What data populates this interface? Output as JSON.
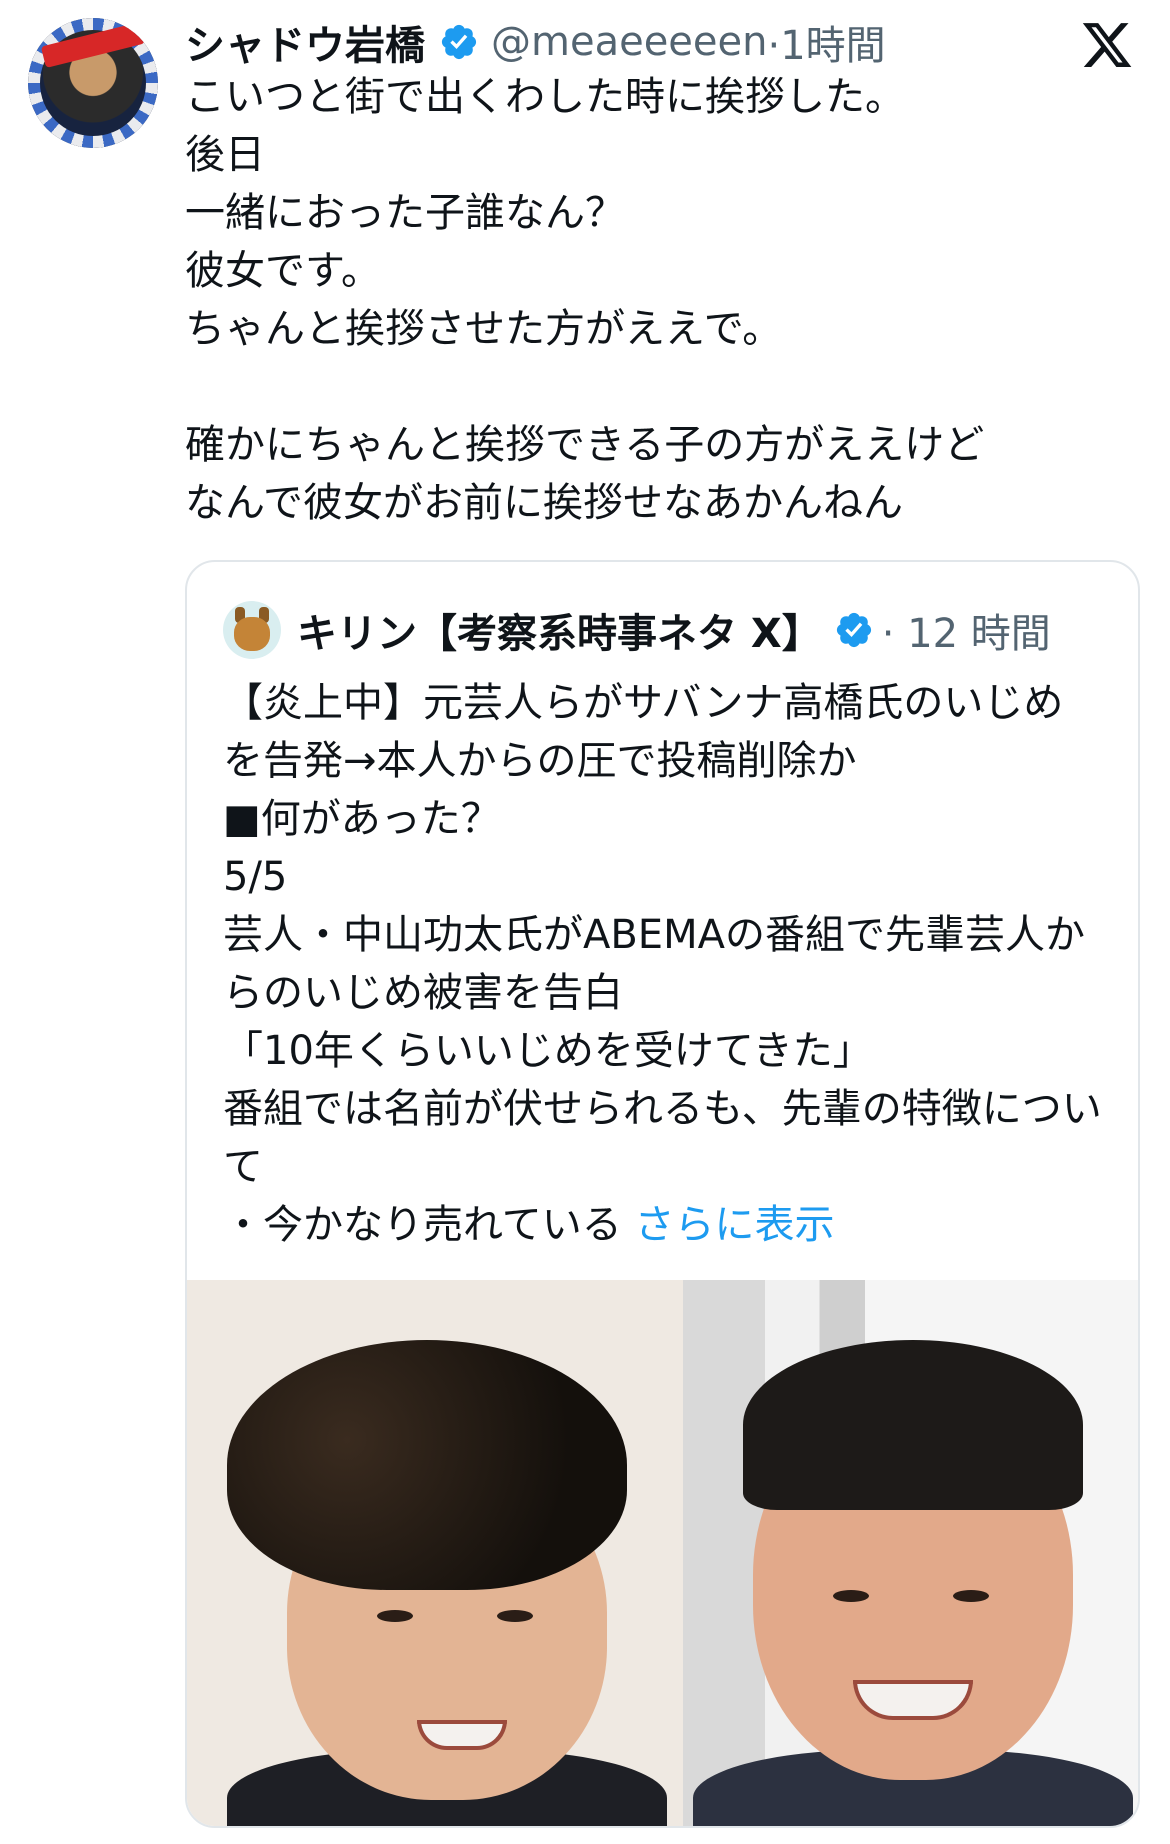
{
  "post": {
    "author_name": "シャドウ岩橋",
    "handle": "@meaeeeeen",
    "time": "·1時間",
    "text": "こいつと街で出くわした時に挨拶した。\n後日\n一緒におった子誰なん？\n彼女です。\nちゃんと挨拶させた方がええで。\n\n確かにちゃんと挨拶できる子の方がええけど\nなんで彼女がお前に挨拶せなあかんねん",
    "avatar_icon": "avatar-shadow-iwahashi",
    "verified_icon": "verified-badge-icon",
    "verified_color": "#1d9bf0"
  },
  "app": {
    "logo_icon": "x-logo-icon"
  },
  "quote": {
    "author_name": "キリン【考察系時事ネタ X】",
    "time": "· 12 時間",
    "text": "【炎上中】元芸人らがサバンナ高橋氏のいじめを告発→本人からの圧で投稿削除か\n■何があった？\n5/5\n芸人・中山功太氏がABEMAの番組で先輩芸人からのいじめ被害を告白\n「10年くらいいじめを受けてきた」\n番組では名前が伏せられるも、先輩の特徴について\n・今かなり売れている ",
    "show_more": "さらに表示",
    "avatar_icon": "giraffe-avatar-icon",
    "link_color": "#1d9bf0",
    "media": [
      {
        "name": "photo-left",
        "description": ""
      },
      {
        "name": "photo-right",
        "description": ""
      }
    ]
  },
  "colors": {
    "text": "#0f1419",
    "secondary": "#536471",
    "border": "#e1e6ea"
  }
}
